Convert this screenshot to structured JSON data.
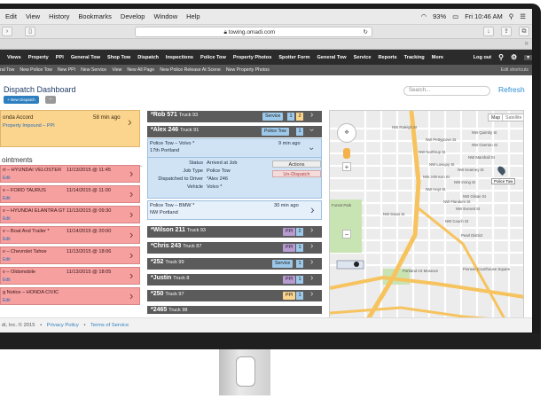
{
  "mac_menu": [
    "Edit",
    "View",
    "History",
    "Bookmarks",
    "Develop",
    "Window",
    "Help"
  ],
  "mac_status": {
    "battery": "93%",
    "clock": "Fri 10:46 AM"
  },
  "browser": {
    "url": "towing.omadi.com"
  },
  "nav": {
    "items": [
      "Views",
      "Property",
      "PPI",
      "General Tow",
      "Shop Tow",
      "Dispatch",
      "Inspections",
      "Police Tow",
      "Property Photos",
      "Spotter Form",
      "General Tow",
      "Service",
      "Reports",
      "Tracking",
      "More"
    ],
    "logout": "Log out"
  },
  "subnav": {
    "items": [
      "ral Tow",
      "New Police Tow",
      "New PPI",
      "New Service",
      "View",
      "New All Page",
      "New Police Release At Scene",
      "New Property Photos"
    ],
    "right": "Edit shortcuts"
  },
  "page": {
    "title": "Dispatch Dashboard",
    "new_dispatch": "+ New Dispatch",
    "minus": "–",
    "search_placeholder": "Search...",
    "refresh": "Refresh"
  },
  "pickup": {
    "name": "onda Accord",
    "sub": "Property Impound – PPI",
    "time": "58 min ago"
  },
  "appointments": {
    "title": "ointments",
    "items": [
      {
        "name": "rt – HYUNDAI VELOSTER",
        "date": "11/13/2015 @ 11:45",
        "sub": "Edit"
      },
      {
        "name": "v – FORD TAURUS",
        "date": "11/14/2015 @ 11:00",
        "sub": "Edit"
      },
      {
        "name": "v – HYUNDAI ELANTRA GT",
        "date": "11/13/2015 @ 09:30",
        "sub": "Edit"
      },
      {
        "name": "v – Boat And Trailer *",
        "date": "11/14/2015 @ 20:00",
        "sub": "Edit"
      },
      {
        "name": "v – Chevrolet Tahoe",
        "date": "11/13/2015 @ 18:06",
        "sub": "Edit"
      },
      {
        "name": "v – Oldsmobile",
        "date": "11/13/2015 @ 18:05",
        "sub": "Edit"
      },
      {
        "name": "g Notice – HONDA CIVIC",
        "date": "",
        "sub": "Edit"
      }
    ]
  },
  "trucks": [
    {
      "driver": "*Rob 571",
      "truck": "Truck 93",
      "badge": "Service",
      "badge_type": "service",
      "counts": [
        "1",
        "2"
      ]
    },
    {
      "driver": "*Alex 246",
      "truck": "Truck 91",
      "badge": "Police Tow",
      "badge_type": "tow",
      "counts": [
        "1"
      ]
    },
    {
      "driver": "*Wilson 211",
      "truck": "Truck 93",
      "badge": "PPI",
      "badge_type": "ppi",
      "counts": [
        "2"
      ]
    },
    {
      "driver": "*Chris 243",
      "truck": "Truck 87",
      "badge": "PPI",
      "badge_type": "ppi",
      "counts": [
        "1"
      ]
    },
    {
      "driver": "*252",
      "truck": "Truck 99",
      "badge": "Service",
      "badge_type": "service",
      "counts": [
        "1"
      ]
    },
    {
      "driver": "*Justin",
      "truck": "Truck 8",
      "badge": "PPI",
      "badge_type": "ppi",
      "counts": [
        "1"
      ]
    },
    {
      "driver": "*250",
      "truck": "Truck 97",
      "badge": "PPI",
      "badge_type": "ppi",
      "counts": [
        "1"
      ]
    },
    {
      "driver": "*2465",
      "truck": "Truck 98",
      "badge": "",
      "badge_type": "",
      "counts": []
    }
  ],
  "job1": {
    "name": "Police Tow – Volvo *",
    "address": "17th Portland",
    "time": "9 min ago",
    "status_label": "Status",
    "status": "Arrived at Job",
    "jobtype_label": "Job Type",
    "jobtype": "Police Tow",
    "driver_label": "Dispatched to Driver",
    "driver": "*Alex 246",
    "vehicle_label": "Vehicle",
    "vehicle": "Volvo *",
    "actions": "Actions",
    "undispatch": "Un-Dispatch"
  },
  "job2": {
    "name": "Police Tow – BMW *",
    "address": "NW Portland",
    "time": "30 min ago"
  },
  "map": {
    "tab_map": "Map",
    "tab_satellite": "Satellite",
    "pin_label": "Police Tow",
    "labels": [
      "NW Raleigh St",
      "NW Quimby St",
      "NW Pettygrove St",
      "NW Overton St",
      "NW Northrup St",
      "NW Marshall St",
      "NW Lovejoy St",
      "NW Kearney St",
      "NW Johnson St",
      "NW Irving St",
      "NW Hoyt St",
      "NW Glisan St",
      "NW Flanders St",
      "NW Everett St",
      "NW Davis St",
      "NW Couch St",
      "Pearl District",
      "Forest Park",
      "Portland Art Museum",
      "Pioneer Courthouse Square"
    ],
    "colors": {
      "road": "#f6c35e",
      "street": "#ffffff",
      "park": "#c9e4b3",
      "bg": "#ececec"
    }
  },
  "footer": {
    "copyright": "di, Inc. © 2015",
    "privacy": "Privacy Policy",
    "terms": "Terms of Service"
  },
  "colors": {
    "accent": "#2d7fc0",
    "pickup": "#fbd58e",
    "appointment": "#f6a0a0",
    "truck": "#5b5b5b",
    "job": "#cfe3f5"
  }
}
